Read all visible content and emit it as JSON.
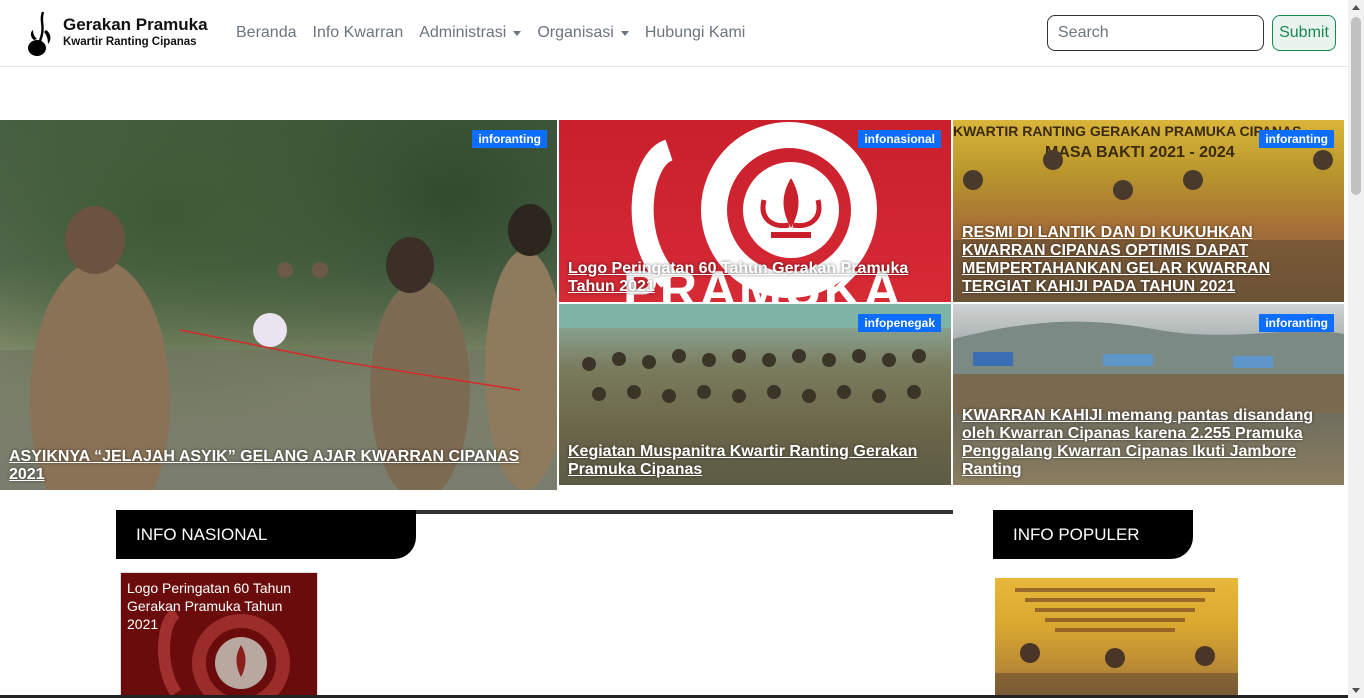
{
  "brand": {
    "title": "Gerakan Pramuka",
    "subtitle": "Kwartir Ranting Cipanas"
  },
  "nav": {
    "items": [
      {
        "label": "Beranda"
      },
      {
        "label": "Info Kwarran"
      },
      {
        "label": "Administrasi"
      },
      {
        "label": "Organisasi"
      },
      {
        "label": "Hubungi Kami"
      }
    ]
  },
  "search": {
    "placeholder": "Search",
    "value": "",
    "submit_label": "Submit"
  },
  "hero": {
    "cards": [
      {
        "badge": "inforanting",
        "title": "ASYIKNYA “JELAJAH ASYIK” GELANG AJAR KWARRAN CIPANAS 2021"
      },
      {
        "badge": "infonasional",
        "title": "Logo Peringatan 60 Tahun Gerakan Pramuka Tahun 2021"
      },
      {
        "badge": "inforanting",
        "title": "RESMI DI LANTIK DAN DI KUKUHKAN KWARRAN CIPANAS OPTIMIS DAPAT MEMPERTAHANKAN GELAR KWARRAN TERGIAT KAHIJI PADA TAHUN 2021"
      },
      {
        "badge": "infopenegak",
        "title": "Kegiatan Muspanitra Kwartir Ranting Gerakan Pramuka Cipanas"
      },
      {
        "badge": "inforanting",
        "title": "KWARRAN KAHIJI memang pantas disandang oleh Kwarran Cipanas karena 2.255 Pramuka Penggalang Kwarran Cipanas Ikuti Jambore Ranting"
      }
    ],
    "image_text": {
      "card2_logo": "PRAMUKA",
      "card3_banner_line1": "KWARTIR RANTING GERAKAN PRAMUKA CIPANAS",
      "card3_banner_line2": "MASA BAKTI 2021 - 2024"
    }
  },
  "sections": {
    "nasional": {
      "heading": "INFO NASIONAL",
      "posts": [
        {
          "title": "Logo Peringatan 60 Tahun Gerakan Pramuka Tahun 2021"
        }
      ]
    },
    "populer": {
      "heading": "INFO POPULER"
    }
  },
  "colors": {
    "badge": "#0d6efd",
    "submit": "#198754",
    "nav_text": "#6c757d",
    "section_header": "#000000"
  },
  "icons": {
    "brand_logo": "pramuka-tunas-kelapa-icon",
    "dropdown": "caret-down-icon"
  }
}
